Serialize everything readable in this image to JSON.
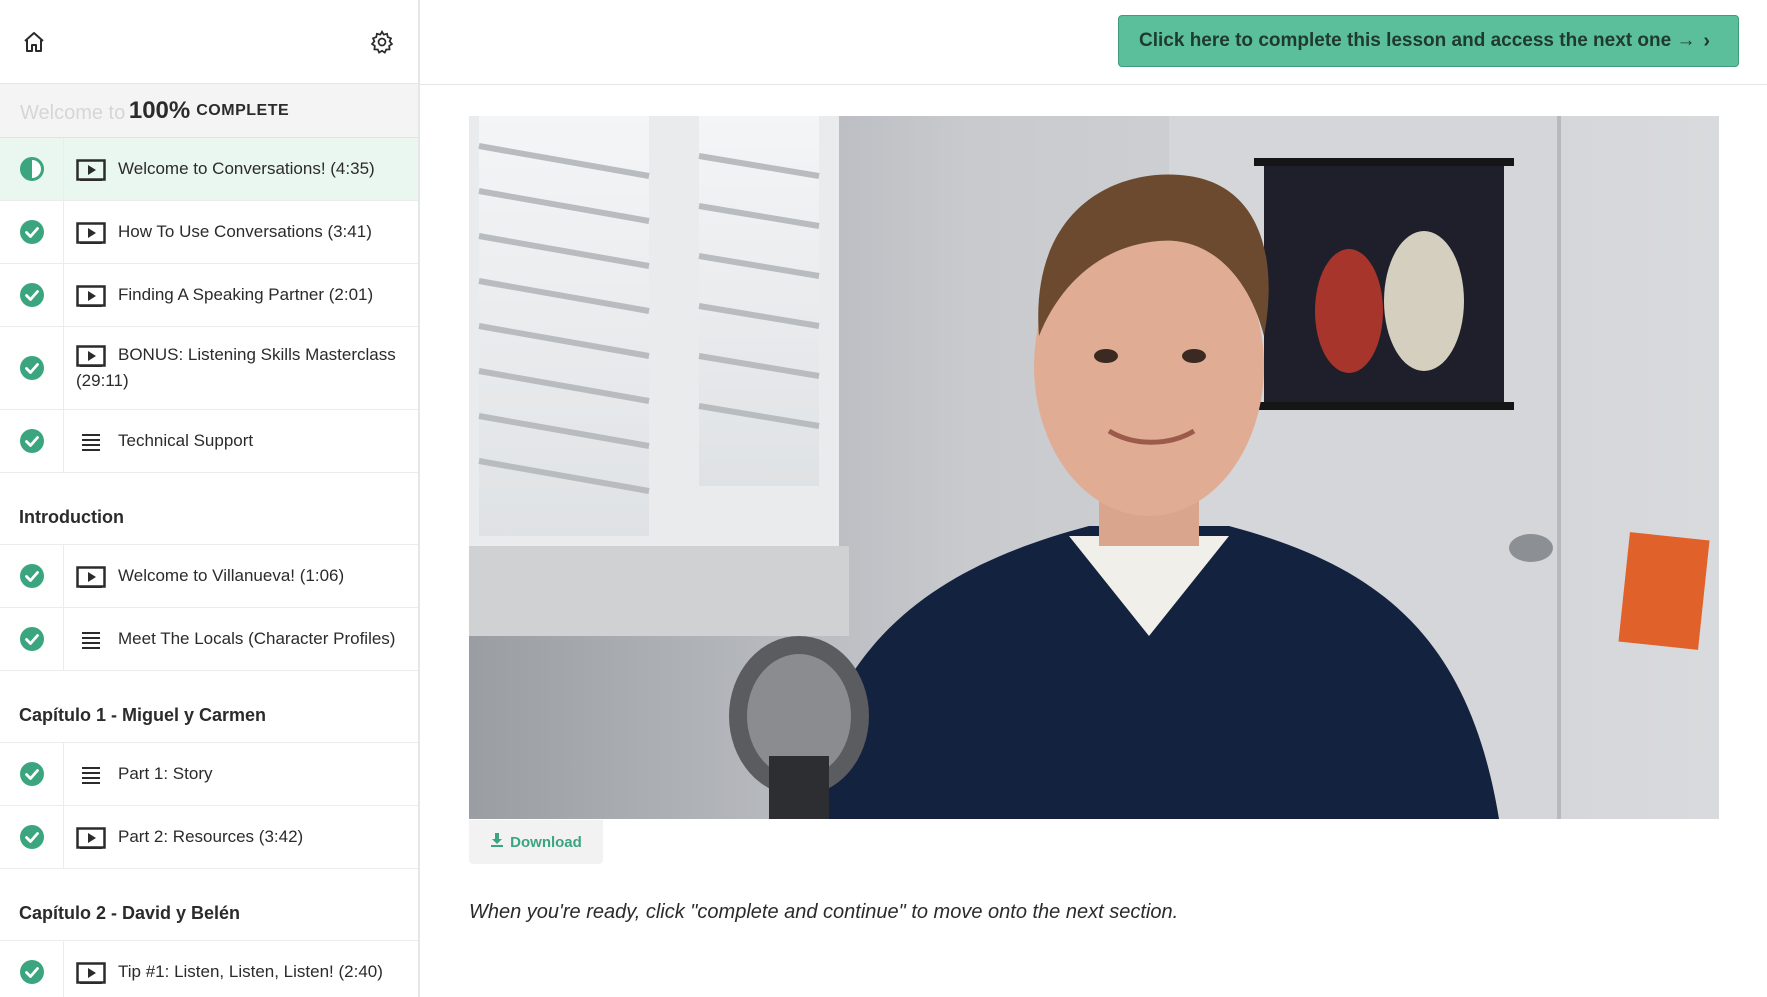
{
  "sidebar": {
    "progress": {
      "percent": "100%",
      "label": "COMPLETE",
      "ghost_text": "Welcome to"
    },
    "sections": [
      {
        "title": "",
        "lessons": [
          {
            "label": "Welcome to Conversations! (4:35)",
            "type": "video",
            "status": "current"
          },
          {
            "label": "How To Use Conversations (3:41)",
            "type": "video",
            "status": "complete"
          },
          {
            "label": "Finding A Speaking Partner (2:01)",
            "type": "video",
            "status": "complete"
          },
          {
            "label": "BONUS: Listening Skills Masterclass (29:11)",
            "type": "video",
            "status": "complete"
          },
          {
            "label": "Technical Support",
            "type": "text",
            "status": "complete"
          }
        ]
      },
      {
        "title": "Introduction",
        "lessons": [
          {
            "label": "Welcome to Villanueva! (1:06)",
            "type": "video",
            "status": "complete"
          },
          {
            "label": "Meet The Locals (Character Profiles)",
            "type": "text",
            "status": "complete"
          }
        ]
      },
      {
        "title": "Capítulo 1 - Miguel y Carmen",
        "lessons": [
          {
            "label": "Part 1: Story",
            "type": "text",
            "status": "complete"
          },
          {
            "label": "Part 2: Resources (3:42)",
            "type": "video",
            "status": "complete"
          }
        ]
      },
      {
        "title": "Capítulo 2 - David y Belén",
        "lessons": [
          {
            "label": "Tip #1: Listen, Listen, Listen! (2:40)",
            "type": "video",
            "status": "complete"
          }
        ]
      }
    ]
  },
  "main": {
    "complete_button_label": "Click here to complete this lesson and access the next one →",
    "complete_button_chevron": "›",
    "download_label": "Download",
    "note": "When you're ready, click \"complete and continue\" to move onto the next section."
  },
  "colors": {
    "accent_green": "#5bbf9b",
    "check_green": "#3aa57f",
    "active_row": "#eaf7f1"
  }
}
